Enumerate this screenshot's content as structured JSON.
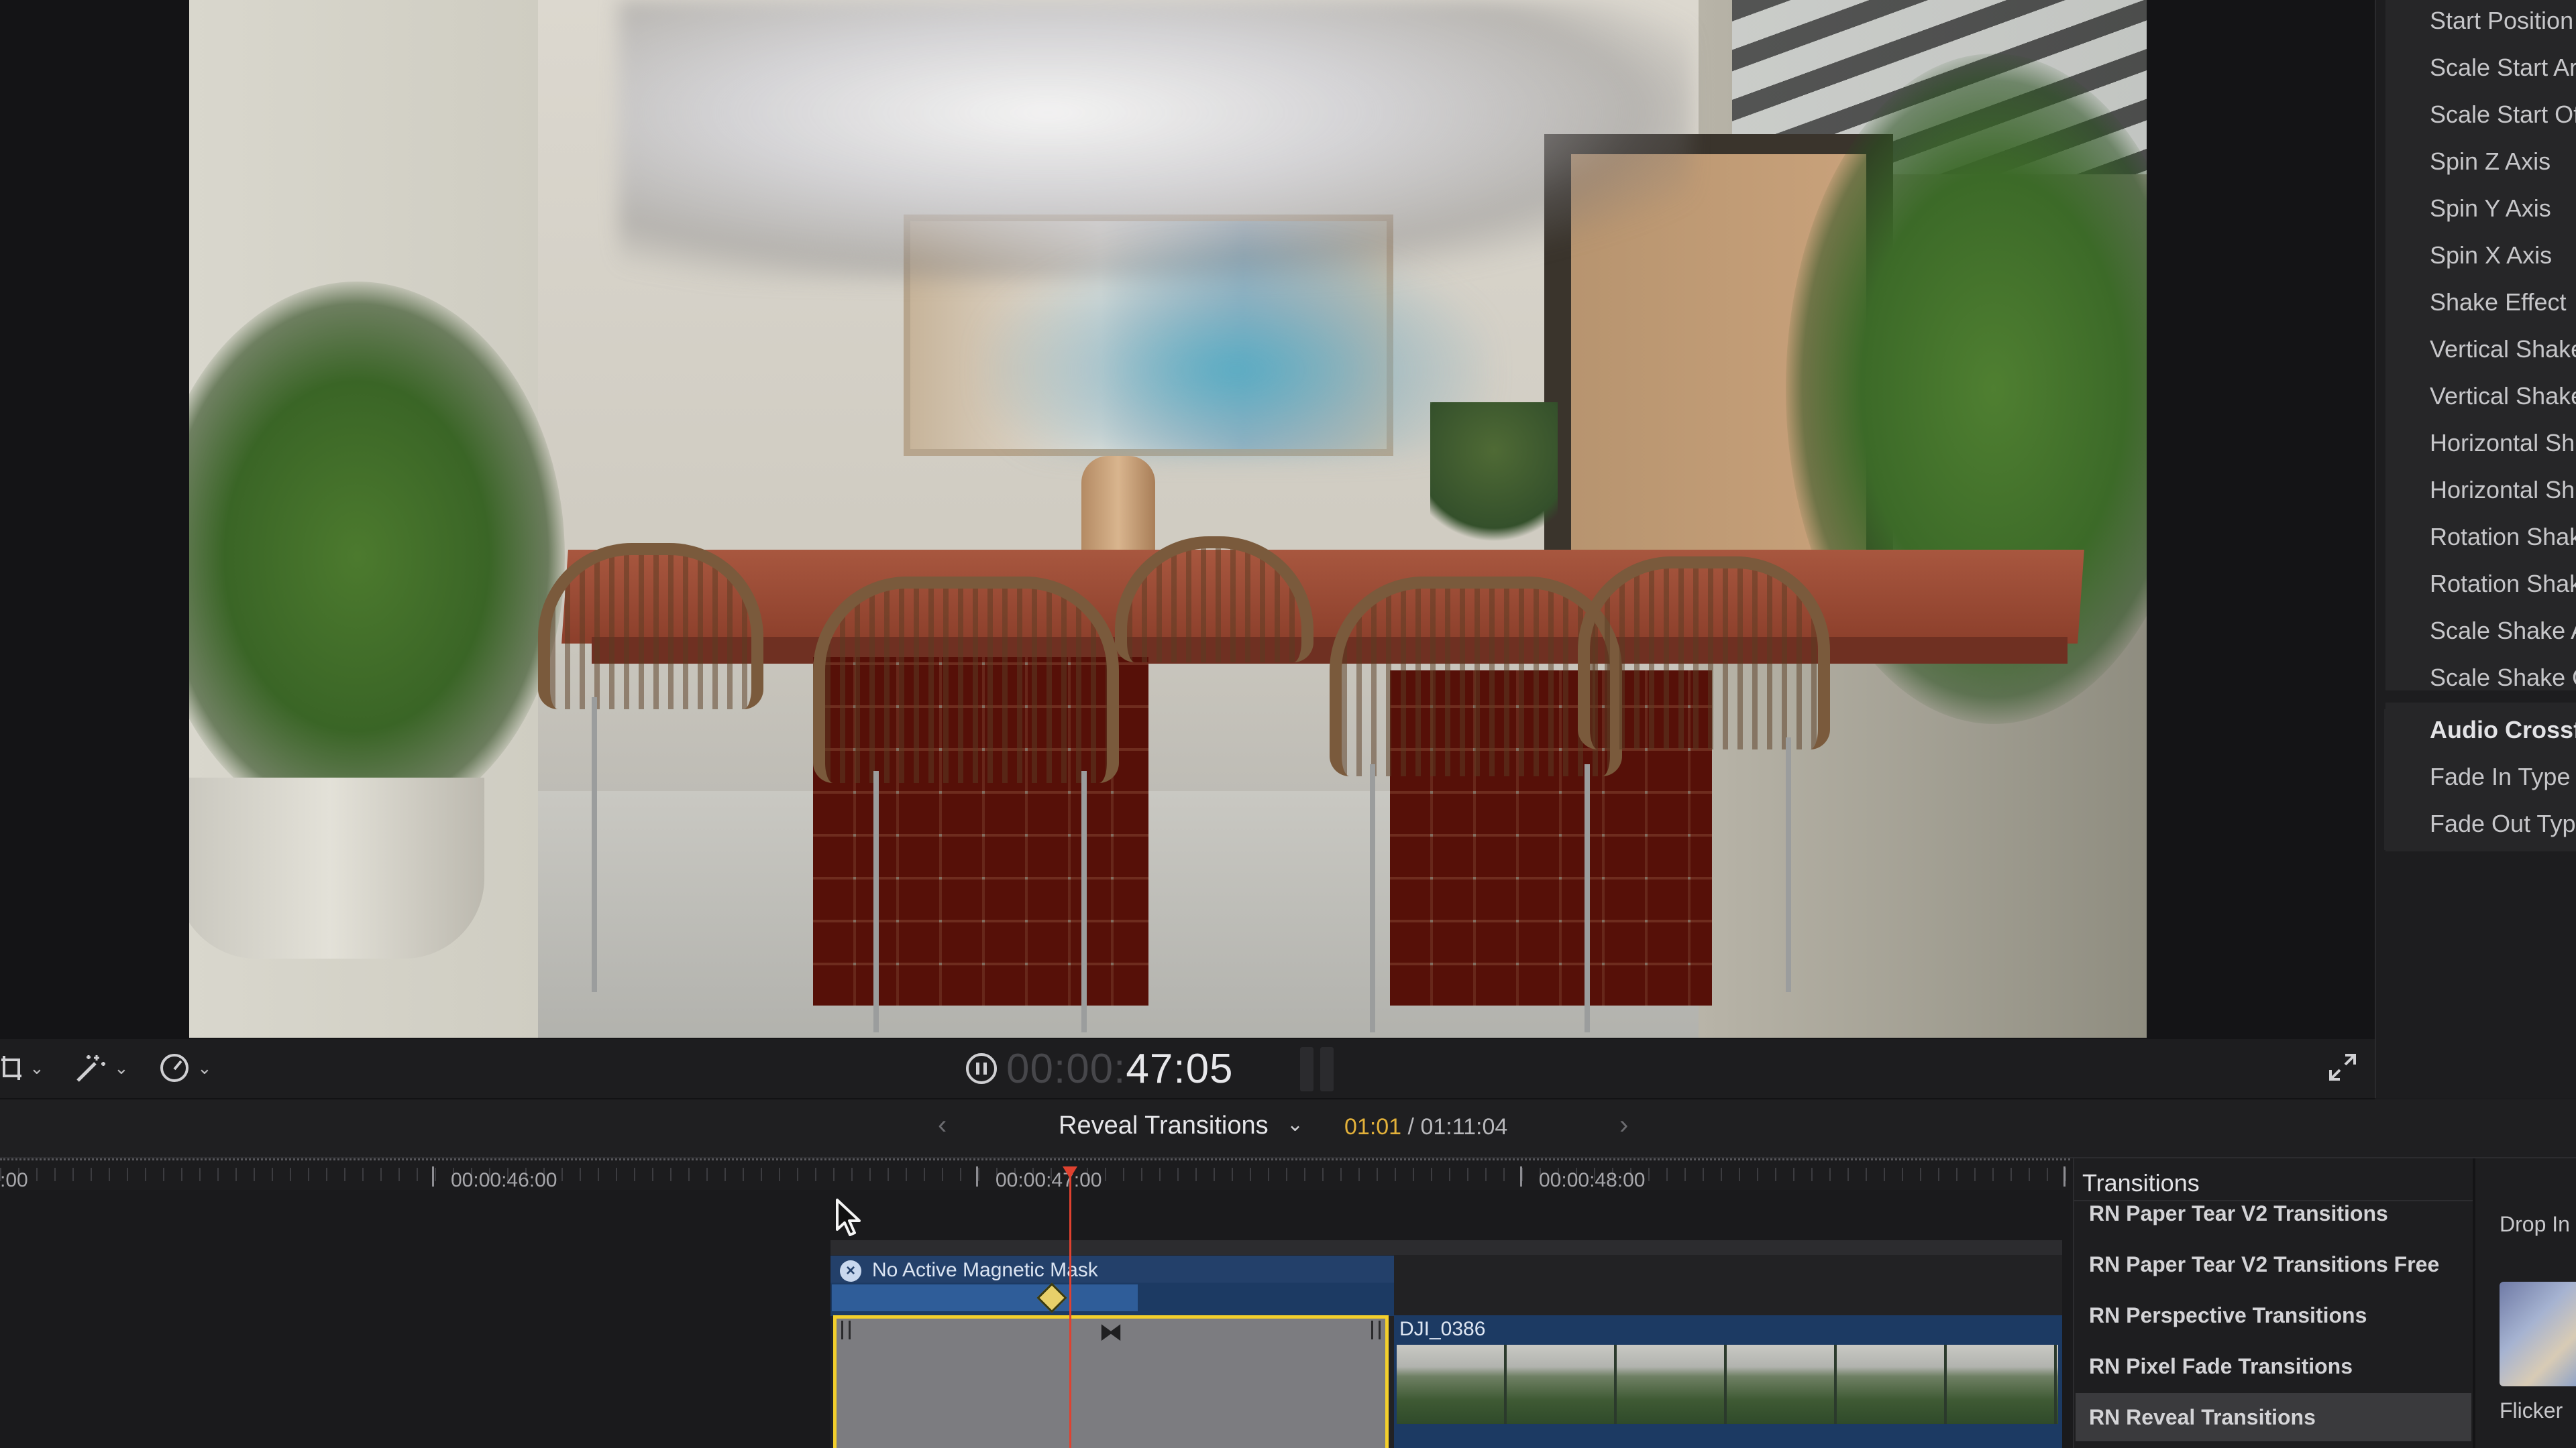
{
  "viewer": {
    "timecode_dim": "00:00:",
    "timecode_main": "47:05"
  },
  "viewer_toolbar": {
    "crop_icon": "crop-icon",
    "enhance_icon": "magic-wand-icon",
    "speed_icon": "speedometer-icon",
    "fullscreen_icon": "fullscreen-icon"
  },
  "inspector": {
    "items": [
      "Start Position",
      "Scale Start Ar",
      "Scale Start Of",
      "Spin Z Axis",
      "Spin Y Axis",
      "Spin X Axis",
      "Shake Effect",
      "Vertical Shake",
      "Vertical Shake",
      "Horizontal Sh",
      "Horizontal Sh",
      "Rotation Shak",
      "Rotation Shak",
      "Scale Shake A",
      "Scale Shake O"
    ],
    "audio_section": "Audio Crossfa",
    "audio_items": [
      "Fade In Type",
      "Fade Out Typ"
    ]
  },
  "timeline_header": {
    "project_name": "Reveal Transitions",
    "current_time": "01:01",
    "separator": " / ",
    "total_time": "01:11:04"
  },
  "ruler": {
    "labels": [
      ":00",
      "00:00:46:00",
      "00:00:47:00",
      "00:00:48:00"
    ]
  },
  "timeline": {
    "mask_label": "No Active Magnetic Mask",
    "clip_name": "DJI_0386"
  },
  "browser": {
    "title": "Transitions",
    "categories": [
      "RN Paper Tear V2 Transitions",
      "RN Paper Tear V2 Transitions Free",
      "RN Perspective Transitions",
      "RN Pixel Fade Transitions",
      "RN Reveal Transitions"
    ],
    "selected_category": "RN Reveal Transitions",
    "effect_partial": "Drop In",
    "effect_thumb_label": "Flicker"
  },
  "colors": {
    "accent_yellow": "#f3cf2c",
    "playhead_red": "#e0412f",
    "clip_blue": "#1c3a63",
    "time_orange": "#e3b13a"
  }
}
